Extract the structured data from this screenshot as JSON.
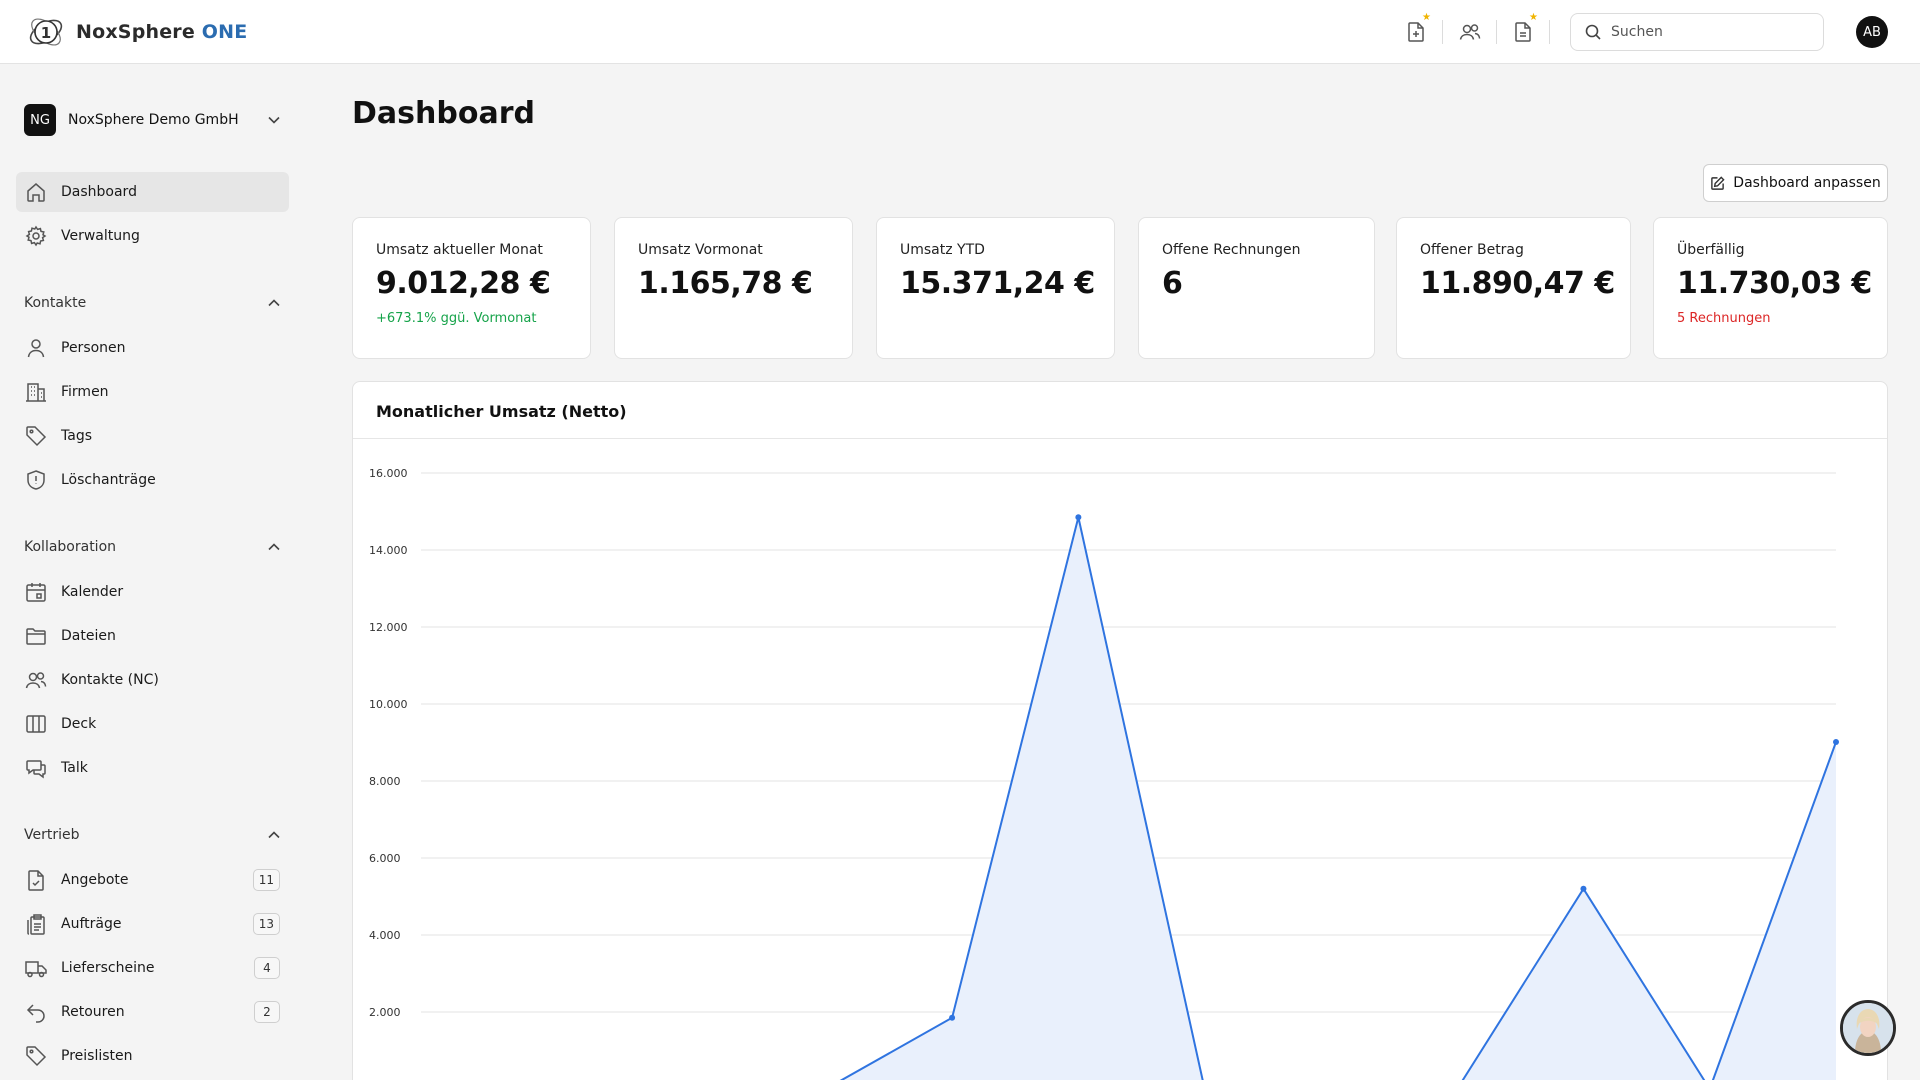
{
  "header": {
    "brand_name": "NoxSphere",
    "brand_accent": "ONE",
    "search_placeholder": "Suchen",
    "avatar_initials": "AB"
  },
  "sidebar": {
    "org_initials": "NG",
    "org_name": "NoxSphere Demo GmbH",
    "top_items": [
      {
        "label": "Dashboard",
        "icon": "home-icon",
        "active": true
      },
      {
        "label": "Verwaltung",
        "icon": "gear-icon"
      }
    ],
    "sections": [
      {
        "title": "Kontakte",
        "items": [
          {
            "label": "Personen",
            "icon": "person-icon"
          },
          {
            "label": "Firmen",
            "icon": "building-icon"
          },
          {
            "label": "Tags",
            "icon": "tag-icon"
          },
          {
            "label": "Löschanträge",
            "icon": "shield-icon"
          }
        ]
      },
      {
        "title": "Kollaboration",
        "items": [
          {
            "label": "Kalender",
            "icon": "calendar-icon"
          },
          {
            "label": "Dateien",
            "icon": "folder-icon"
          },
          {
            "label": "Kontakte (NC)",
            "icon": "users-icon"
          },
          {
            "label": "Deck",
            "icon": "columns-icon"
          },
          {
            "label": "Talk",
            "icon": "chat-icon"
          }
        ]
      },
      {
        "title": "Vertrieb",
        "items": [
          {
            "label": "Angebote",
            "icon": "doc-check-icon",
            "count": "11"
          },
          {
            "label": "Aufträge",
            "icon": "clipboard-icon",
            "count": "13"
          },
          {
            "label": "Lieferscheine",
            "icon": "truck-icon",
            "count": "4"
          },
          {
            "label": "Retouren",
            "icon": "return-icon",
            "count": "2"
          },
          {
            "label": "Preislisten",
            "icon": "tag-icon"
          }
        ]
      }
    ]
  },
  "main": {
    "title": "Dashboard",
    "customize_label": "Dashboard anpassen",
    "kpis": [
      {
        "label": "Umsatz aktueller Monat",
        "value": "9.012,28 €",
        "sub": "+673.1% ggü. Vormonat",
        "sub_color": "green"
      },
      {
        "label": "Umsatz Vormonat",
        "value": "1.165,78 €",
        "sub": ""
      },
      {
        "label": "Umsatz YTD",
        "value": "15.371,24 €",
        "sub": ""
      },
      {
        "label": "Offene Rechnungen",
        "value": "6",
        "sub": ""
      },
      {
        "label": "Offener Betrag",
        "value": "11.890,47 €",
        "sub": ""
      },
      {
        "label": "Überfällig",
        "value": "11.730,03 €",
        "sub": "5 Rechnungen",
        "sub_color": "red"
      }
    ],
    "chart_title": "Monatlicher Umsatz (Netto)"
  },
  "chart_data": {
    "type": "area",
    "title": "Monatlicher Umsatz (Netto)",
    "y_ticks": [
      "2.000",
      "4.000",
      "6.000",
      "8.000",
      "10.000",
      "12.000",
      "14.000",
      "16.000"
    ],
    "ylim": [
      0,
      16000
    ],
    "x": [
      0,
      1,
      2,
      3,
      4,
      5,
      6,
      7,
      8,
      9,
      10,
      11
    ],
    "values": [
      0,
      0,
      0,
      0,
      1850,
      14850,
      0,
      0,
      0,
      5200,
      0,
      9012.28
    ],
    "grid": true,
    "colors": {
      "line": "#2f74e0",
      "fill": "#e9f0fc"
    }
  }
}
